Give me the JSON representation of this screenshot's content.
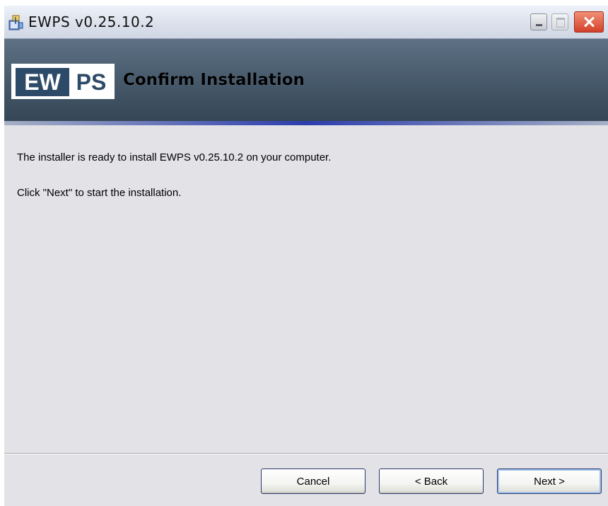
{
  "window": {
    "title": "EWPS v0.25.10.2"
  },
  "banner": {
    "logo_left": "EW",
    "logo_right": "PS",
    "heading": "Confirm Installation"
  },
  "content": {
    "line1": "The installer is ready to install EWPS v0.25.10.2 on your computer.",
    "line2": "Click \"Next\" to start the installation."
  },
  "buttons": {
    "cancel": "Cancel",
    "back": "< Back",
    "next": "Next >"
  },
  "colors": {
    "banner_dark": "#344655",
    "logo_blue": "#2d4b68",
    "close_red": "#d3402a",
    "dialog_bg": "#e3e2e7"
  },
  "icons": {
    "app": "installer-package-icon",
    "minimize": "minimize-icon",
    "maximize": "maximize-icon",
    "close": "close-icon"
  }
}
